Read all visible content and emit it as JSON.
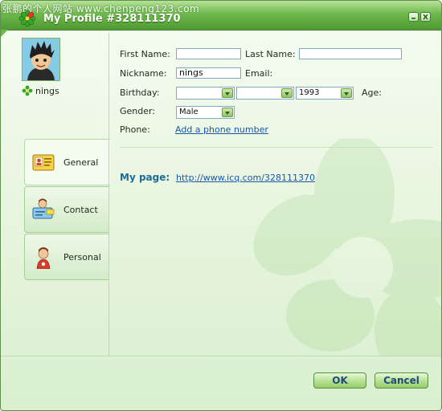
{
  "watermark": "张鹏的个人网站  www.chenpeng123.com",
  "window": {
    "title": "My Profile #328111370"
  },
  "profile": {
    "nickname_display": "nings"
  },
  "tabs": [
    {
      "label": "General",
      "icon": "id-card-icon",
      "active": true
    },
    {
      "label": "Contact",
      "icon": "contact-card-icon",
      "active": false
    },
    {
      "label": "Personal",
      "icon": "person-icon",
      "active": false
    }
  ],
  "form": {
    "first_name_label": "First Name:",
    "first_name_value": "",
    "last_name_label": "Last Name:",
    "last_name_value": "",
    "nickname_label": "Nickname:",
    "nickname_value": "nings",
    "email_label": "Email:",
    "birthday_label": "Birthday:",
    "birthday_month": "",
    "birthday_day": "",
    "birthday_year": "1993",
    "age_label": "Age:",
    "gender_label": "Gender:",
    "gender_value": "Male",
    "phone_label": "Phone:",
    "add_phone_link": "Add a phone number"
  },
  "mypage": {
    "label": "My page:",
    "url": "http://www.icq.com/328111370"
  },
  "buttons": {
    "ok": "OK",
    "cancel": "Cancel"
  },
  "colors": {
    "accent_green": "#6fb84d",
    "link_blue": "#1a57a6",
    "title_text": "#ffffff"
  }
}
